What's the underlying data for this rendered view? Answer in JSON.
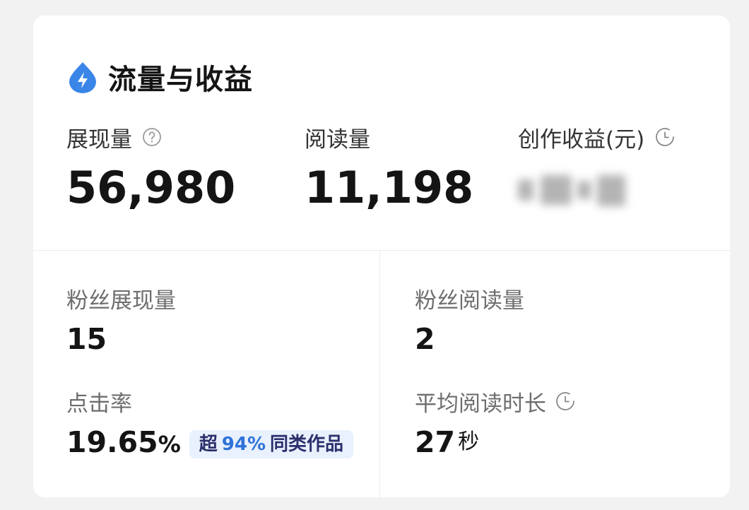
{
  "card": {
    "title": "流量与收益",
    "title_icon": "blue-drop-lightning-icon",
    "accent_color": "#3a86e8"
  },
  "metrics": [
    {
      "label": "展现量",
      "value": "56,980",
      "icon": "question-mark-icon"
    },
    {
      "label": "阅读量",
      "value": "11,198"
    },
    {
      "label": "创作收益(元)",
      "value": "",
      "icon": "clock-icon",
      "value_state": "blurred"
    }
  ],
  "stats": {
    "fan_impressions": {
      "label": "粉丝展现量",
      "value": "15"
    },
    "fan_reads": {
      "label": "粉丝阅读量",
      "value": "2"
    },
    "ctr": {
      "label": "点击率",
      "value": "19.65",
      "unit": "%",
      "badge": {
        "prefix": "超",
        "highlight": "94%",
        "suffix": "同类作品"
      }
    },
    "avg_read_time": {
      "label": "平均阅读时长",
      "value": "27",
      "unit": "秒",
      "icon": "clock-icon"
    }
  }
}
